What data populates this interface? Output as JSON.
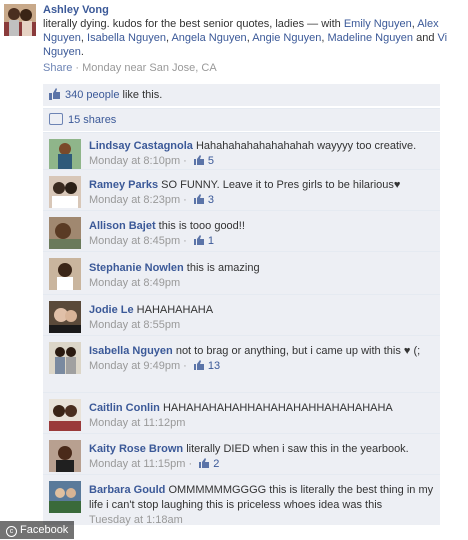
{
  "post": {
    "author": "Ashley Vong",
    "text": "literally dying. kudos for the best senior quotes, ladies",
    "with_prefix": " — with ",
    "tagged": [
      "Emily Nguyen",
      "Alex Nguyen",
      "Isabella Nguyen",
      "Angela Nguyen",
      "Angie Nguyen",
      "Madeline Nguyen"
    ],
    "and_label": " and ",
    "last_tagged": "Vi Nguyen",
    "share_label": "Share",
    "meta": " · Monday near San Jose, CA"
  },
  "likes": {
    "count": "340 people",
    "suffix": " like this."
  },
  "shares": {
    "label": "15 shares"
  },
  "comments": [
    {
      "author": "Lindsay Castagnola",
      "text": " Hahahahahahahahahah wayyyy too creative.",
      "time": "Monday at 8:10pm",
      "likes": "5"
    },
    {
      "author": "Ramey Parks",
      "text": " SO FUNNY. Leave it to Pres girls to be hilarious♥",
      "time": "Monday at 8:23pm",
      "likes": "3"
    },
    {
      "author": "Allison Bajet",
      "text": " this is tooo good!!",
      "time": "Monday at 8:45pm",
      "likes": "1"
    },
    {
      "author": "Stephanie Nowlen",
      "text": " this is amazing",
      "time": "Monday at 8:49pm",
      "likes": ""
    },
    {
      "author": "Jodie Le",
      "text": " HAHAHAHAHA",
      "time": "Monday at 8:55pm",
      "likes": ""
    },
    {
      "author": "Isabella Nguyen",
      "text": " not to brag or anything, but i came up with this ♥ (;",
      "time": "Monday at 9:49pm",
      "likes": "13"
    },
    {
      "author": "Caitlin Conlin",
      "text": " HAHAHAHAHAHHAHAHAHAHHAHAHAHAHA",
      "time": "Monday at 11:12pm",
      "likes": ""
    },
    {
      "author": "Kaity Rose Brown",
      "text": " literally DIED when i saw this in the yearbook.",
      "time": "Monday at 11:15pm",
      "likes": "2"
    },
    {
      "author": "Barbara Gould",
      "text": " OMMMMMMGGGG this is literally the best thing in my life i can't stop laughing this is priceless whoes idea was this",
      "time": "Tuesday at 1:18am",
      "likes": ""
    }
  ],
  "watermark": {
    "symbol": "c",
    "label": "Facebook"
  },
  "colors": {
    "link": "#3b5998",
    "ufi_bg": "#edeff4",
    "meta": "#999999"
  },
  "icons": {
    "like": "thumbs-up-icon",
    "share": "share-icon"
  }
}
